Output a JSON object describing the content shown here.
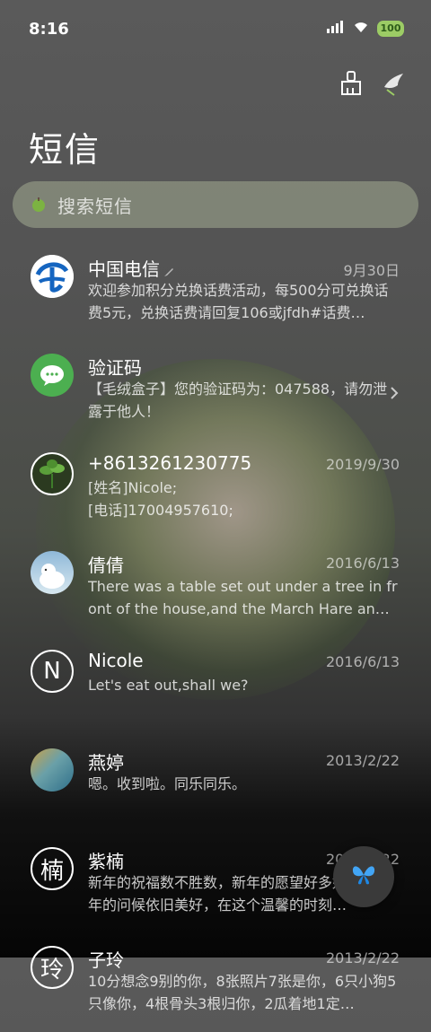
{
  "status": {
    "time": "8:16",
    "battery": "100"
  },
  "header": {
    "title": "短信"
  },
  "search": {
    "placeholder": "搜索短信"
  },
  "conversations": [
    {
      "name": "中国电信",
      "date": "9月30日",
      "preview": "欢迎参加积分兑换话费活动，每500分可兑换话费5元，兑换话费请回复106或jfdh#话费…",
      "avatar": "telecom-logo"
    },
    {
      "name": "验证码",
      "date": "",
      "preview": "【毛绒盒子】您的验证码为：047588，请勿泄露于他人！",
      "avatar": "message-icon"
    },
    {
      "name": "+8613261230775",
      "date": "2019/9/30",
      "preview": "[姓名]Nicole;\n[电话]17004957610;",
      "avatar": "plant-photo"
    },
    {
      "name": "倩倩",
      "date": "2016/6/13",
      "preview": "There was a table set out under a tree in front of the house,and the March Hare an…",
      "avatar": "polar-bear-photo"
    },
    {
      "name": "Nicole",
      "date": "2016/6/13",
      "preview": "Let's eat out,shall we?",
      "avatar_letter": "N"
    },
    {
      "name": "燕婷",
      "date": "2013/2/22",
      "preview": "嗯。收到啦。同乐同乐。",
      "avatar": "landscape-photo"
    },
    {
      "name": "紫楠",
      "date": "2013/2/22",
      "preview": "新年的祝福数不胜数，新年的愿望好多好多，新年的问候依旧美好，在这个温馨的时刻…",
      "avatar_letter": "楠"
    },
    {
      "name": "子玲",
      "date": "2013/2/22",
      "preview": "10分想念9别的你，8张照片7张是你，6只小狗5只像你，4根骨头3根归你，2瓜着地1定…",
      "avatar_letter": "玲"
    }
  ],
  "colors": {
    "accent": "#4caf50",
    "telecom_blue": "#1565c0"
  }
}
